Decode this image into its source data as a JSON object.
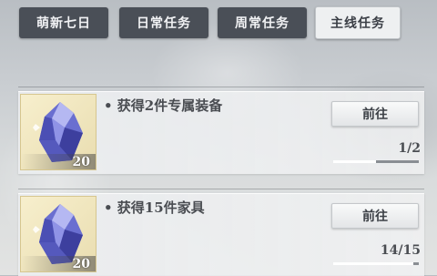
{
  "tabs": [
    {
      "label": "萌新七日",
      "active": false
    },
    {
      "label": "日常任务",
      "active": false
    },
    {
      "label": "周常任务",
      "active": false
    },
    {
      "label": "主线任务",
      "active": true
    }
  ],
  "tasks": [
    {
      "description": "• 获得2件专属装备",
      "reward_icon": "blue-crystal-icon",
      "reward_count": "20",
      "button_label": "前往",
      "progress_text": "1/2",
      "progress": 0.5
    },
    {
      "description": "• 获得15件家具",
      "reward_icon": "blue-crystal-icon",
      "reward_count": "20",
      "button_label": "前往",
      "progress_text": "14/15",
      "progress": 0.933
    }
  ],
  "colors": {
    "tab_bg": "#4a4f57",
    "tab_active_bg": "#eef0f1",
    "reward_bg": "#f7efcd",
    "crystal": "#5f64c8"
  }
}
